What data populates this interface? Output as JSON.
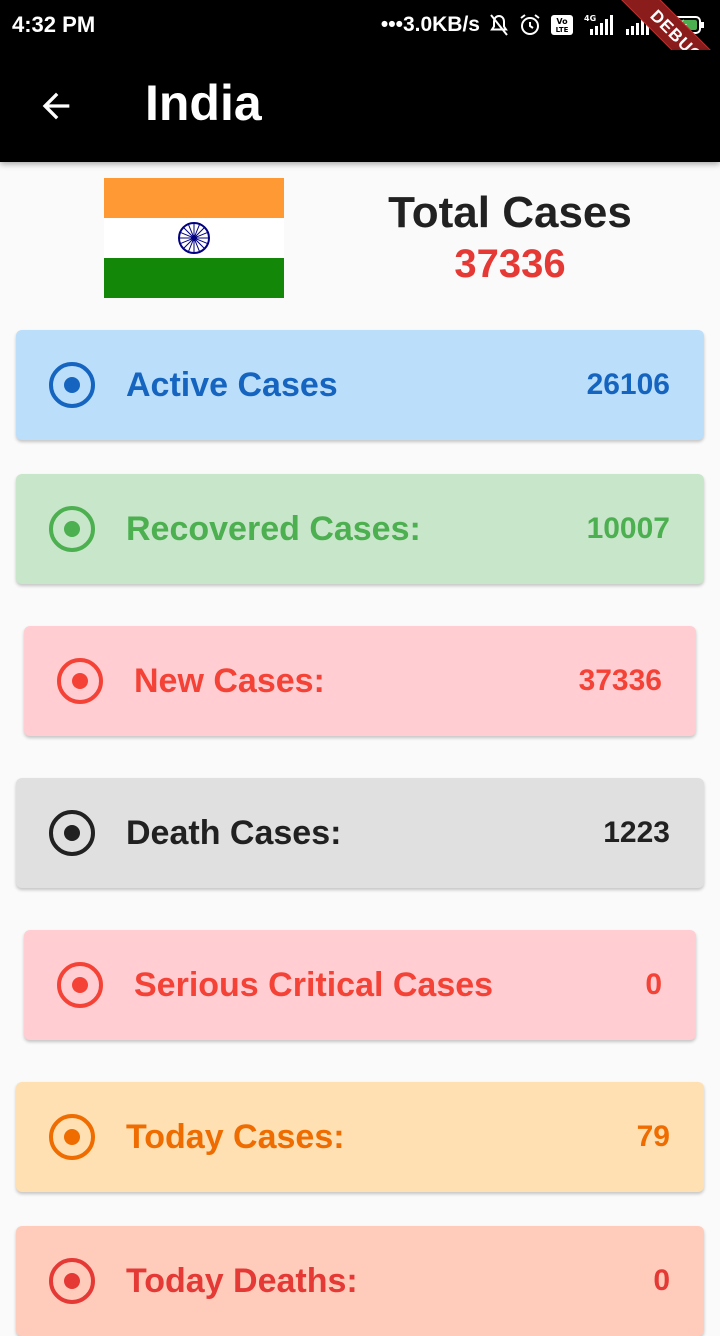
{
  "status_bar": {
    "time": "4:32 PM",
    "network_speed": "3.0KB/s",
    "volte": "Vo LTE",
    "network_type": "4G",
    "debug_banner": "DEBUG"
  },
  "app_bar": {
    "title": "India",
    "back_icon": "arrow-back-icon"
  },
  "summary": {
    "flag": "india-flag",
    "total_label": "Total Cases",
    "total_value": "37336"
  },
  "cards": [
    {
      "label": "Active Cases",
      "value": "26106",
      "bg": "#bbdefb",
      "fg": "#1565c0",
      "icon": "radio-button-checked-icon"
    },
    {
      "label": "Recovered Cases:",
      "value": "10007",
      "bg": "#c8e6c9",
      "fg": "#4caf50",
      "icon": "radio-button-checked-icon"
    },
    {
      "label": "New Cases:",
      "value": "37336",
      "bg": "#ffcdd2",
      "fg": "#f44336",
      "icon": "radio-button-checked-icon"
    },
    {
      "label": "Death Cases:",
      "value": "1223",
      "bg": "#e0e0e0",
      "fg": "#212121",
      "icon": "radio-button-checked-icon"
    },
    {
      "label": "Serious Critical Cases",
      "value": "0",
      "bg": "#ffcdd2",
      "fg": "#f44336",
      "icon": "radio-button-checked-icon"
    },
    {
      "label": "Today Cases:",
      "value": "79",
      "bg": "#ffe0b2",
      "fg": "#ef6c00",
      "icon": "radio-button-checked-icon"
    },
    {
      "label": "Today Deaths:",
      "value": "0",
      "bg": "#ffccbc",
      "fg": "#e53935",
      "icon": "radio-button-checked-icon"
    }
  ]
}
